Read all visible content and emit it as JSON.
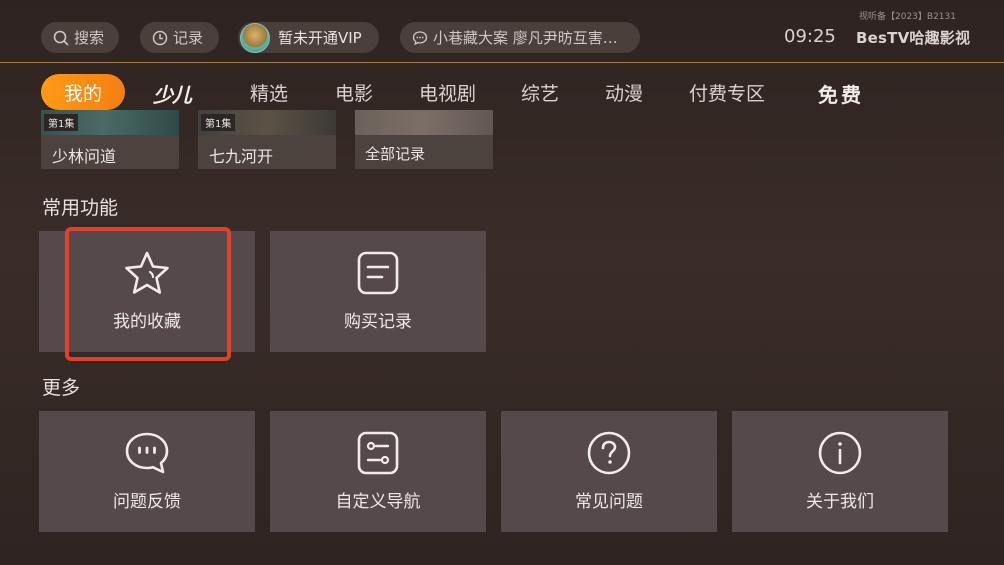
{
  "header": {
    "search_label": "搜索",
    "record_label": "记录",
    "vip_label": "暂未开通VIP",
    "marquee_text": "小巷藏大案 廖凡尹昉互害…",
    "clock": "09:25",
    "brand": "BesTV哈趣影视",
    "license": "视听备【2023】B2131"
  },
  "tabs": [
    {
      "label": "我的",
      "active": true
    },
    {
      "label": "少儿"
    },
    {
      "label": "精选"
    },
    {
      "label": "电影"
    },
    {
      "label": "电视剧"
    },
    {
      "label": "综艺"
    },
    {
      "label": "动漫"
    },
    {
      "label": "付费专区"
    },
    {
      "label": "免费"
    }
  ],
  "history": [
    {
      "episode": "第1集",
      "title": "少林问道"
    },
    {
      "episode": "第1集",
      "title": "七九河开"
    },
    {
      "title": "全部记录"
    }
  ],
  "sections": {
    "common": "常用功能",
    "more": "更多"
  },
  "common_tiles": [
    {
      "label": "我的收藏",
      "icon": "star-icon",
      "focused": true
    },
    {
      "label": "购买记录",
      "icon": "list-icon"
    }
  ],
  "more_tiles": [
    {
      "label": "问题反馈",
      "icon": "chat-icon"
    },
    {
      "label": "自定义导航",
      "icon": "sliders-icon"
    },
    {
      "label": "常见问题",
      "icon": "question-icon"
    },
    {
      "label": "关于我们",
      "icon": "info-icon"
    }
  ],
  "colors": {
    "accent": "#f37f12",
    "focus": "#e2402d",
    "divider": "#a57a40"
  }
}
